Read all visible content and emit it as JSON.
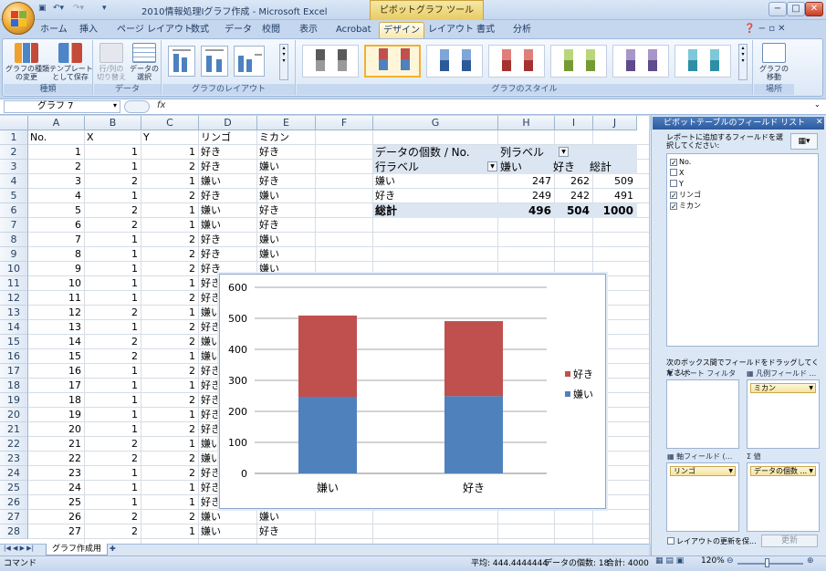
{
  "window": {
    "title": "2010情報処理Ⅰグラフ作成 - Microsoft Excel",
    "context_tool": "ピボットグラフ ツール",
    "controls": {
      "minimize": "−",
      "maximize": "□",
      "close": "✕"
    }
  },
  "tabs": [
    "ホーム",
    "挿入",
    "ページ レイアウト",
    "数式",
    "データ",
    "校閲",
    "表示",
    "Acrobat",
    "デザイン",
    "レイアウト",
    "書式",
    "分析"
  ],
  "active_tab": "デザイン",
  "ribbon": {
    "groups": {
      "type": {
        "label": "種類",
        "buttons": [
          "グラフの種類\nの変更",
          "テンプレート\nとして保存"
        ]
      },
      "data": {
        "label": "データ",
        "buttons": [
          "行/列の\n切り替え",
          "データの\n選択"
        ]
      },
      "layout": {
        "label": "グラフのレイアウト"
      },
      "style": {
        "label": "グラフのスタイル"
      },
      "location": {
        "label": "場所",
        "buttons": [
          "グラフの\n移動"
        ]
      }
    }
  },
  "formula_bar": {
    "name_box": "グラフ 7",
    "fx": "fx",
    "content": ""
  },
  "columns": [
    "A",
    "B",
    "C",
    "D",
    "E",
    "F",
    "G",
    "H",
    "I",
    "J"
  ],
  "rows": [
    [
      "No.",
      "X",
      "Y",
      "リンゴ",
      "ミカン"
    ],
    [
      "1",
      "1",
      "1",
      "好き",
      "好き"
    ],
    [
      "2",
      "1",
      "2",
      "好き",
      "嫌い"
    ],
    [
      "3",
      "2",
      "1",
      "嫌い",
      "好き"
    ],
    [
      "4",
      "1",
      "2",
      "好き",
      "嫌い"
    ],
    [
      "5",
      "2",
      "1",
      "嫌い",
      "好き"
    ],
    [
      "6",
      "2",
      "1",
      "嫌い",
      "好き"
    ],
    [
      "7",
      "1",
      "2",
      "好き",
      "嫌い"
    ],
    [
      "8",
      "1",
      "2",
      "好き",
      "嫌い"
    ],
    [
      "9",
      "1",
      "2",
      "好き",
      "嫌い"
    ],
    [
      "10",
      "1",
      "1",
      "好き",
      ""
    ],
    [
      "11",
      "1",
      "2",
      "好き",
      ""
    ],
    [
      "12",
      "2",
      "1",
      "嫌い",
      ""
    ],
    [
      "13",
      "1",
      "2",
      "好き",
      ""
    ],
    [
      "14",
      "2",
      "2",
      "嫌い",
      ""
    ],
    [
      "15",
      "2",
      "1",
      "嫌い",
      ""
    ],
    [
      "16",
      "1",
      "2",
      "好き",
      ""
    ],
    [
      "17",
      "1",
      "1",
      "好き",
      ""
    ],
    [
      "18",
      "1",
      "2",
      "好き",
      ""
    ],
    [
      "19",
      "1",
      "1",
      "好き",
      ""
    ],
    [
      "20",
      "1",
      "2",
      "好き",
      ""
    ],
    [
      "21",
      "2",
      "1",
      "嫌い",
      ""
    ],
    [
      "22",
      "2",
      "2",
      "嫌い",
      ""
    ],
    [
      "23",
      "1",
      "2",
      "好き",
      ""
    ],
    [
      "24",
      "1",
      "1",
      "好き",
      ""
    ],
    [
      "25",
      "1",
      "1",
      "好き",
      ""
    ],
    [
      "26",
      "2",
      "2",
      "嫌い",
      "嫌い"
    ],
    [
      "27",
      "2",
      "1",
      "嫌い",
      "好き"
    ]
  ],
  "pivot": {
    "title": "データの個数 / No.",
    "col_label": "列ラベル",
    "row_label": "行ラベル",
    "col_headers": [
      "嫌い",
      "好き",
      "総計"
    ],
    "rows": [
      {
        "label": "嫌い",
        "values": [
          "247",
          "262",
          "509"
        ]
      },
      {
        "label": "好き",
        "values": [
          "249",
          "242",
          "491"
        ]
      }
    ],
    "total": {
      "label": "総計",
      "values": [
        "496",
        "504",
        "1000"
      ]
    }
  },
  "chart_data": {
    "type": "bar",
    "stacked": true,
    "categories": [
      "嫌い",
      "好き"
    ],
    "series": [
      {
        "name": "嫌い",
        "values": [
          247,
          249
        ],
        "color": "#4f81bd"
      },
      {
        "name": "好き",
        "values": [
          262,
          242
        ],
        "color": "#c0504d"
      }
    ],
    "y_ticks": [
      "0",
      "100",
      "200",
      "300",
      "400",
      "500",
      "600"
    ],
    "ylim": [
      0,
      600
    ],
    "grid": true,
    "legend": "right"
  },
  "field_list": {
    "title": "ピボットテーブルのフィールド リスト",
    "instruction": "レポートに追加するフィールドを選択してください:",
    "fields": [
      {
        "name": "No.",
        "checked": true
      },
      {
        "name": "X",
        "checked": false
      },
      {
        "name": "Y",
        "checked": false
      },
      {
        "name": "リンゴ",
        "checked": true
      },
      {
        "name": "ミカン",
        "checked": true
      }
    ],
    "drag_hint": "次のボックス間でフィールドをドラッグしてください:",
    "report_filter": "レポート フィルタ",
    "legend_fields": "凡例フィールド ...",
    "axis_fields": "軸フィールド (...",
    "values": "値",
    "legend_item": "ミカン",
    "axis_item": "リンゴ",
    "value_item": "データの個数 ...",
    "defer_update": "レイアウトの更新を保...",
    "update_button": "更新"
  },
  "sheet_tab": "グラフ作成用",
  "status": {
    "mode": "コマンド",
    "average": "平均: 444.4444444",
    "count": "データの個数: 18",
    "sum": "合計: 4000",
    "zoom": "120%"
  }
}
